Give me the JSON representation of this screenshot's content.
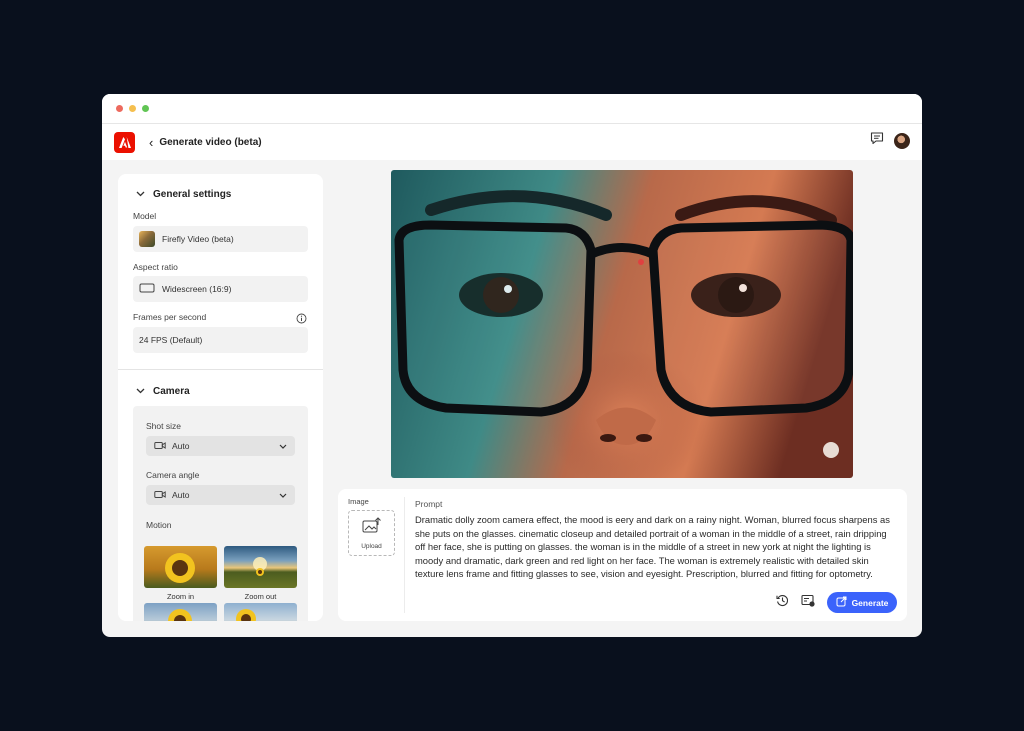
{
  "window": {
    "traffic_lights": [
      "#ed6a5e",
      "#f5bf4f",
      "#61c554"
    ]
  },
  "app": {
    "back_glyph": "‹",
    "title": "Generate video (beta)",
    "brand_color": "#eb1000",
    "icons": [
      "adobe-logo-icon",
      "chevron-left-icon",
      "feedback-icon",
      "user-avatar"
    ]
  },
  "sidebar": {
    "general": {
      "heading": "General settings",
      "model_label": "Model",
      "model_value": "Firefly Video (beta)",
      "aspect_label": "Aspect ratio",
      "aspect_value": "Widescreen (16:9)",
      "fps_label": "Frames per second",
      "fps_value": "24 FPS (Default)"
    },
    "camera": {
      "heading": "Camera",
      "shot_size_label": "Shot size",
      "shot_size_value": "Auto",
      "camera_angle_label": "Camera angle",
      "camera_angle_value": "Auto",
      "motion_label": "Motion",
      "motion_items": [
        {
          "label": "Zoom in"
        },
        {
          "label": "Zoom out"
        },
        {
          "label": ""
        },
        {
          "label": ""
        }
      ]
    }
  },
  "prompt_card": {
    "image_label": "Image",
    "upload_label": "Upload",
    "prompt_label": "Prompt",
    "prompt_text": "Dramatic dolly zoom camera effect, the mood is eery and dark on a rainy night. Woman, blurred focus sharpens as she puts on the glasses. cinematic closeup and detailed portrait of a woman in the middle of a street, rain dripping off her face, she is putting on glasses. the woman is in the middle of a street in new york at night the lighting is moody and dramatic, dark green and red light on her face. The woman is extremely realistic with detailed skin texture lens frame and fitting glasses to see, vision and eyesight. Prescription, blurred and fitting for optometry.",
    "generate_label": "Generate",
    "accent_color": "#3b63fb"
  }
}
